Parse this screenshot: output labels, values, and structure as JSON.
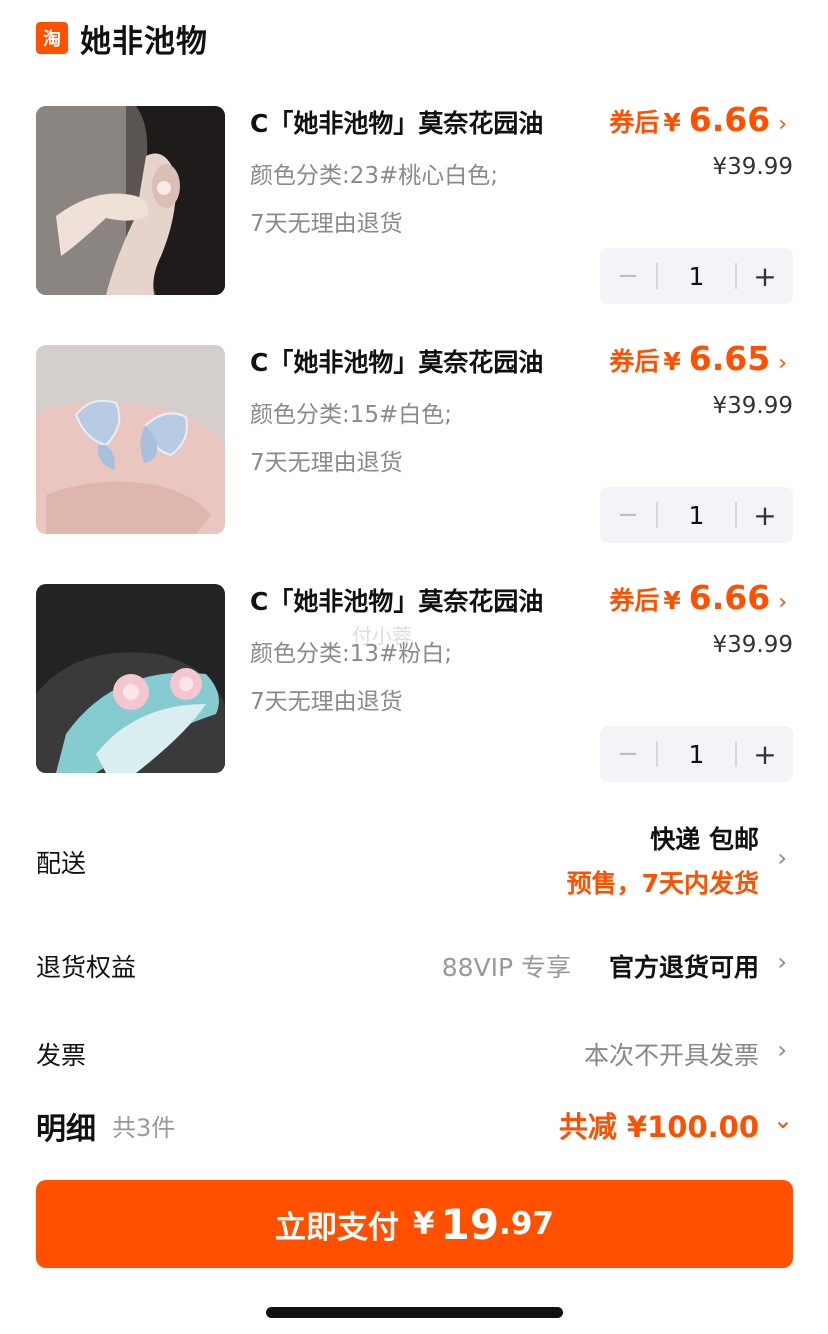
{
  "shop": {
    "logo_text": "淘",
    "name": "她非池物"
  },
  "items": [
    {
      "title": "C「她非池物」莫奈花园油",
      "price_prefix": "券后",
      "currency": "¥",
      "price": "6.66",
      "spec": "颜色分类:23#桃心白色;",
      "original_price": "¥39.99",
      "return_policy": "7天无理由退货",
      "quantity": "1",
      "image": "model-ear-heart-earring"
    },
    {
      "title": "C「她非池物」莫奈花园油",
      "price_prefix": "券后",
      "currency": "¥",
      "price": "6.65",
      "spec": "颜色分类:15#白色;",
      "original_price": "¥39.99",
      "return_policy": "7天无理由退货",
      "quantity": "1",
      "image": "butterfly-earrings-in-hand"
    },
    {
      "title": "C「她非池物」莫奈花园油",
      "price_prefix": "券后",
      "currency": "¥",
      "price": "6.66",
      "spec": "颜色分类:13#粉白;",
      "original_price": "¥39.99",
      "return_policy": "7天无理由退货",
      "quantity": "1",
      "image": "pink-flower-earrings-on-plate"
    }
  ],
  "stepper": {
    "minus": "−",
    "plus": "+"
  },
  "watermark": "付小蓉",
  "shipping": {
    "label": "配送",
    "method": "快递 包邮",
    "note": "预售，7天内发货"
  },
  "returns": {
    "label": "退货权益",
    "vip": "88VIP 专享",
    "value": "官方退货可用"
  },
  "invoice": {
    "label": "发票",
    "value": "本次不开具发票"
  },
  "detail": {
    "label": "明细",
    "count": "共3件",
    "discount": "共减 ¥100.00"
  },
  "pay": {
    "label": "立即支付",
    "currency": "¥",
    "amount_int": "19",
    "amount_dec": ".97"
  },
  "icons": {
    "chevron_right": "›",
    "chevron_double_down": "⌄"
  },
  "colors": {
    "accent": "#ff5000",
    "stepper_bg": "#f2f4f7"
  }
}
